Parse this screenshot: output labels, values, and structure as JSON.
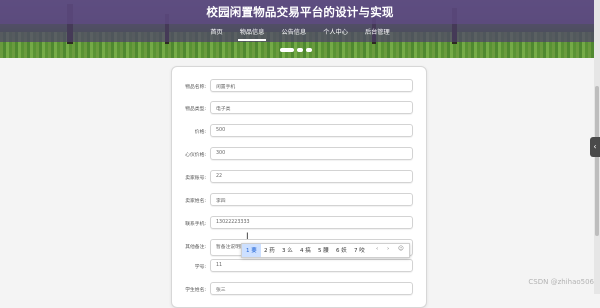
{
  "site": {
    "title": "校园闲置物品交易平台的设计与实现"
  },
  "nav": {
    "items": [
      "首页",
      "物品信息",
      "公告信息",
      "个人中心",
      "后台管理"
    ],
    "active_index": 1
  },
  "form": {
    "rows": [
      {
        "label": "物品名称:",
        "value": "闲置手机"
      },
      {
        "label": "物品类型:",
        "value": "电子类"
      },
      {
        "label": "价格:",
        "value": "500"
      },
      {
        "label": "心仪价格:",
        "value": "300"
      },
      {
        "label": "卖家账号:",
        "value": "22"
      },
      {
        "label": "卖家姓名:",
        "value": "李四"
      },
      {
        "label": "联系手机:",
        "value": "13022223333"
      },
      {
        "label": "其他备注:",
        "value": "暂备注说明阶段"
      },
      {
        "label": "学号:",
        "value": "11"
      },
      {
        "label": "学生姓名:",
        "value": "张三"
      }
    ]
  },
  "ime": {
    "candidates": [
      {
        "num": "1",
        "char": "要"
      },
      {
        "num": "2",
        "char": "药"
      },
      {
        "num": "3",
        "char": "么"
      },
      {
        "num": "4",
        "char": "搞"
      },
      {
        "num": "5",
        "char": "腰"
      },
      {
        "num": "6",
        "char": "妖"
      },
      {
        "num": "7",
        "char": "咬"
      }
    ],
    "prev": "‹",
    "next": "›",
    "settings_glyph": "☺"
  },
  "side_tab": {
    "glyph": "‹"
  },
  "watermark": "CSDN @zhihao506"
}
